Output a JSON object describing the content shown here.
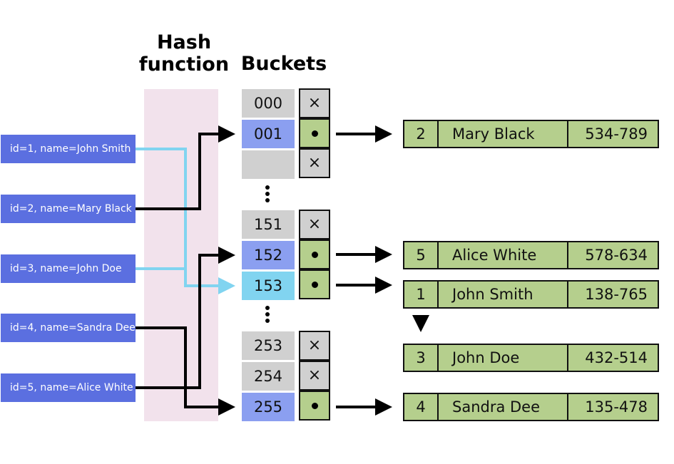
{
  "titles": {
    "hash_function_line1": "Hash",
    "hash_function_line2": "function",
    "buckets": "Buckets"
  },
  "colors": {
    "key_fill": "#5b6fe0",
    "hash_band": "#f2e2ec",
    "bucket_empty": "#d0d0d0",
    "bucket_hit": "#8b9ff0",
    "bucket_collision": "#81d4f0",
    "record_fill": "#b5cf8d",
    "link_black": "#000000",
    "link_cyan": "#81d4f0"
  },
  "keys": [
    {
      "label": "id=1, name=John Smith",
      "bucket": "153"
    },
    {
      "label": "id=2, name=Mary Black",
      "bucket": "001"
    },
    {
      "label": "id=3, name=John Doe",
      "bucket": "153"
    },
    {
      "label": "id=4, name=Sandra Dee",
      "bucket": "255"
    },
    {
      "label": "id=5, name=Alice White",
      "bucket": "152"
    }
  ],
  "buckets": [
    {
      "index": "000",
      "slot": "×"
    },
    {
      "index": "001",
      "slot": "•"
    },
    {
      "index": "",
      "slot": "×"
    },
    {
      "index": "151",
      "slot": "×"
    },
    {
      "index": "152",
      "slot": "•"
    },
    {
      "index": "153",
      "slot": "•"
    },
    {
      "index": "253",
      "slot": "×"
    },
    {
      "index": "254",
      "slot": "×"
    },
    {
      "index": "255",
      "slot": "•"
    }
  ],
  "records": [
    {
      "id": "2",
      "name": "Mary Black",
      "phone": "534-789",
      "bucket": "001"
    },
    {
      "id": "5",
      "name": "Alice White",
      "phone": "578-634",
      "bucket": "152"
    },
    {
      "id": "1",
      "name": "John Smith",
      "phone": "138-765",
      "bucket": "153"
    },
    {
      "id": "3",
      "name": "John Doe",
      "phone": "432-514",
      "bucket": "153",
      "chained_from": "1"
    },
    {
      "id": "4",
      "name": "Sandra Dee",
      "phone": "135-478",
      "bucket": "255"
    }
  ]
}
